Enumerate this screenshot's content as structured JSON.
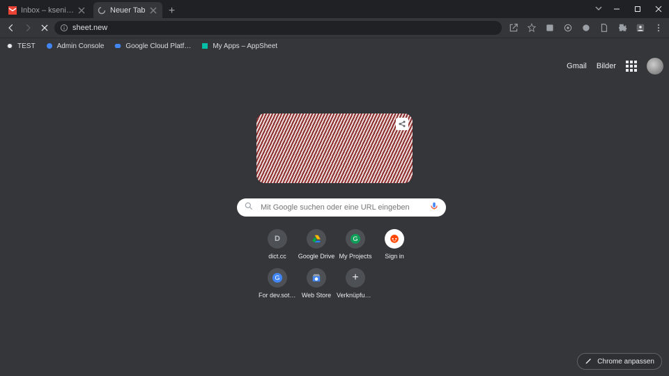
{
  "tabs": {
    "t0": {
      "label": "Inbox – ksenia@dev.cloudwuerdig"
    },
    "t1": {
      "label": "Neuer Tab"
    }
  },
  "omnibox": {
    "url": "sheet.new"
  },
  "bookmarks": {
    "b0": "TEST",
    "b1": "Admin Console",
    "b2": "Google Cloud Platf…",
    "b3": "My Apps – AppSheet"
  },
  "ntp": {
    "gmail": "Gmail",
    "images": "Bilder",
    "search_placeholder": "Mit Google suchen oder eine URL eingeben",
    "shortcuts": {
      "s0": "dict.cc",
      "s1": "Google Drive",
      "s2": "My Projects",
      "s3": "Sign in",
      "s4": "For dev.sotec…",
      "s5": "Web Store",
      "s6": "Verknüpfung …"
    },
    "customize": "Chrome anpassen"
  }
}
